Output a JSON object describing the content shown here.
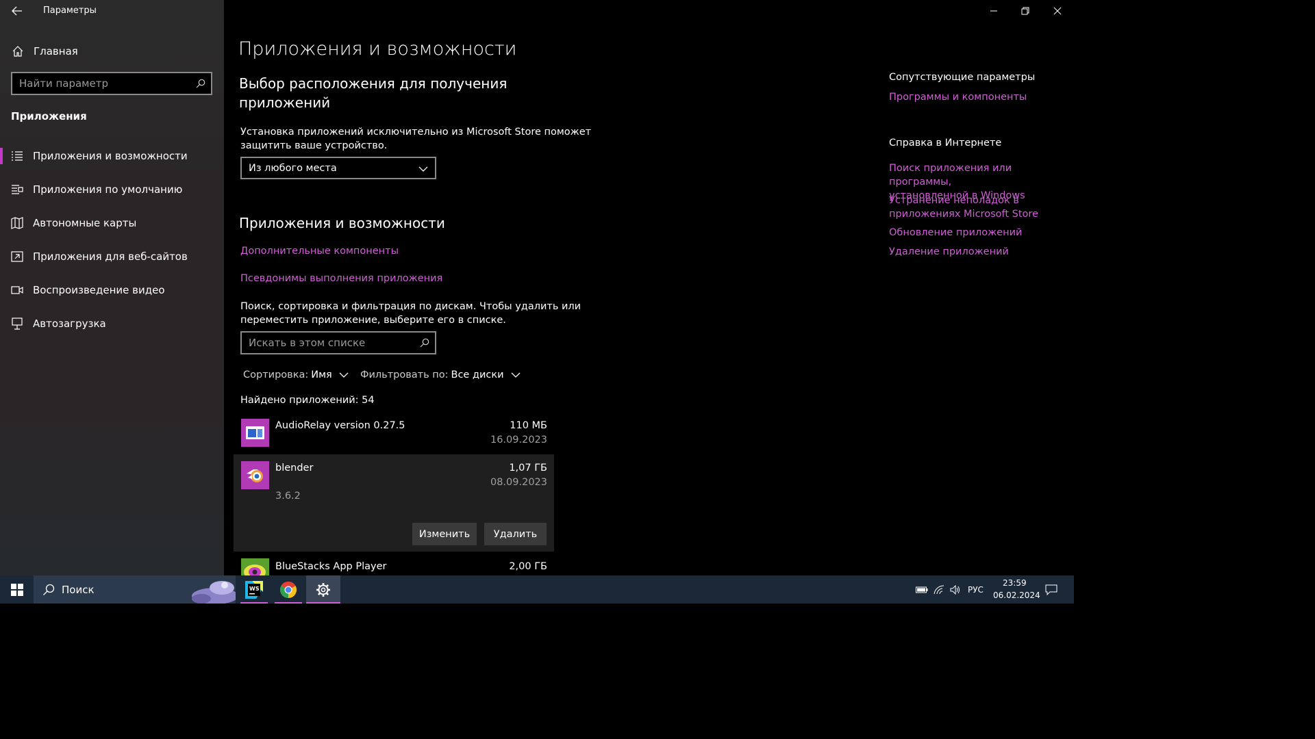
{
  "window": {
    "title": "Параметры",
    "controls": [
      "minimize",
      "restore",
      "close"
    ]
  },
  "sidebar": {
    "home_label": "Главная",
    "search_placeholder": "Найти параметр",
    "section_title": "Приложения",
    "items": [
      {
        "label": "Приложения и возможности",
        "icon": "list-icon",
        "selected": true
      },
      {
        "label": "Приложения по умолчанию",
        "icon": "default-apps-icon",
        "selected": false
      },
      {
        "label": "Автономные карты",
        "icon": "map-icon",
        "selected": false
      },
      {
        "label": "Приложения для веб-сайтов",
        "icon": "web-app-icon",
        "selected": false
      },
      {
        "label": "Воспроизведение видео",
        "icon": "video-icon",
        "selected": false
      },
      {
        "label": "Автозагрузка",
        "icon": "startup-icon",
        "selected": false
      }
    ]
  },
  "main": {
    "page_title": "Приложения и возможности",
    "location_heading": "Выбор расположения для получения приложений",
    "location_heading_line1": "Выбор расположения для получения",
    "location_heading_line2": "приложений",
    "location_desc_line1": "Установка приложений исключительно из Microsoft Store поможет",
    "location_desc_line2": "защитить ваше устройство.",
    "location_dropdown_value": "Из любого места",
    "apps_heading": "Приложения и возможности",
    "link_optional": "Дополнительные компоненты",
    "link_aliases": "Псевдонимы выполнения приложения",
    "search_desc_line1": "Поиск, сортировка и фильтрация по дискам. Чтобы удалить или",
    "search_desc_line2": "переместить приложение, выберите его в списке.",
    "list_search_placeholder": "Искать в этом списке",
    "sort_label": "Сортировка:",
    "sort_value": "Имя",
    "filter_label": "Фильтровать по:",
    "filter_value": "Все диски",
    "found_count": "Найдено приложений: 54",
    "apps": [
      {
        "name": "AudioRelay version 0.27.5",
        "size": "110 МБ",
        "date": "16.09.2023",
        "icon": "audiorelay-icon"
      },
      {
        "name": "blender",
        "size": "1,07 ГБ",
        "date": "08.09.2023",
        "version": "3.6.2",
        "icon": "blender-icon",
        "expanded": true
      },
      {
        "name": "BlueStacks App Player",
        "size": "2,00 ГБ",
        "icon": "bluestacks-icon"
      }
    ],
    "modify_button": "Изменить",
    "uninstall_button": "Удалить"
  },
  "related": {
    "heading": "Сопутствующие параметры",
    "link_programs": "Программы и компоненты",
    "help_heading": "Справка в Интернете",
    "help_links": [
      [
        "Поиск приложения или программы,",
        "установленной в Windows"
      ],
      [
        "Устранение неполадок в",
        "приложениях Microsoft Store"
      ],
      [
        "Обновление приложений"
      ],
      [
        "Удаление приложений"
      ]
    ]
  },
  "taskbar": {
    "search_label": "Поиск",
    "apps": [
      "webstorm-icon",
      "chrome-icon",
      "settings-icon"
    ],
    "language": "РУС",
    "time": "23:59",
    "date": "06.02.2024"
  },
  "colors": {
    "accent": "#d05fd6",
    "sidebar_bg": "#2a2628",
    "taskbar_bg": "#1b2838",
    "selected_row_bg": "#1f1f1f",
    "button_bg": "#3a3a3a"
  }
}
